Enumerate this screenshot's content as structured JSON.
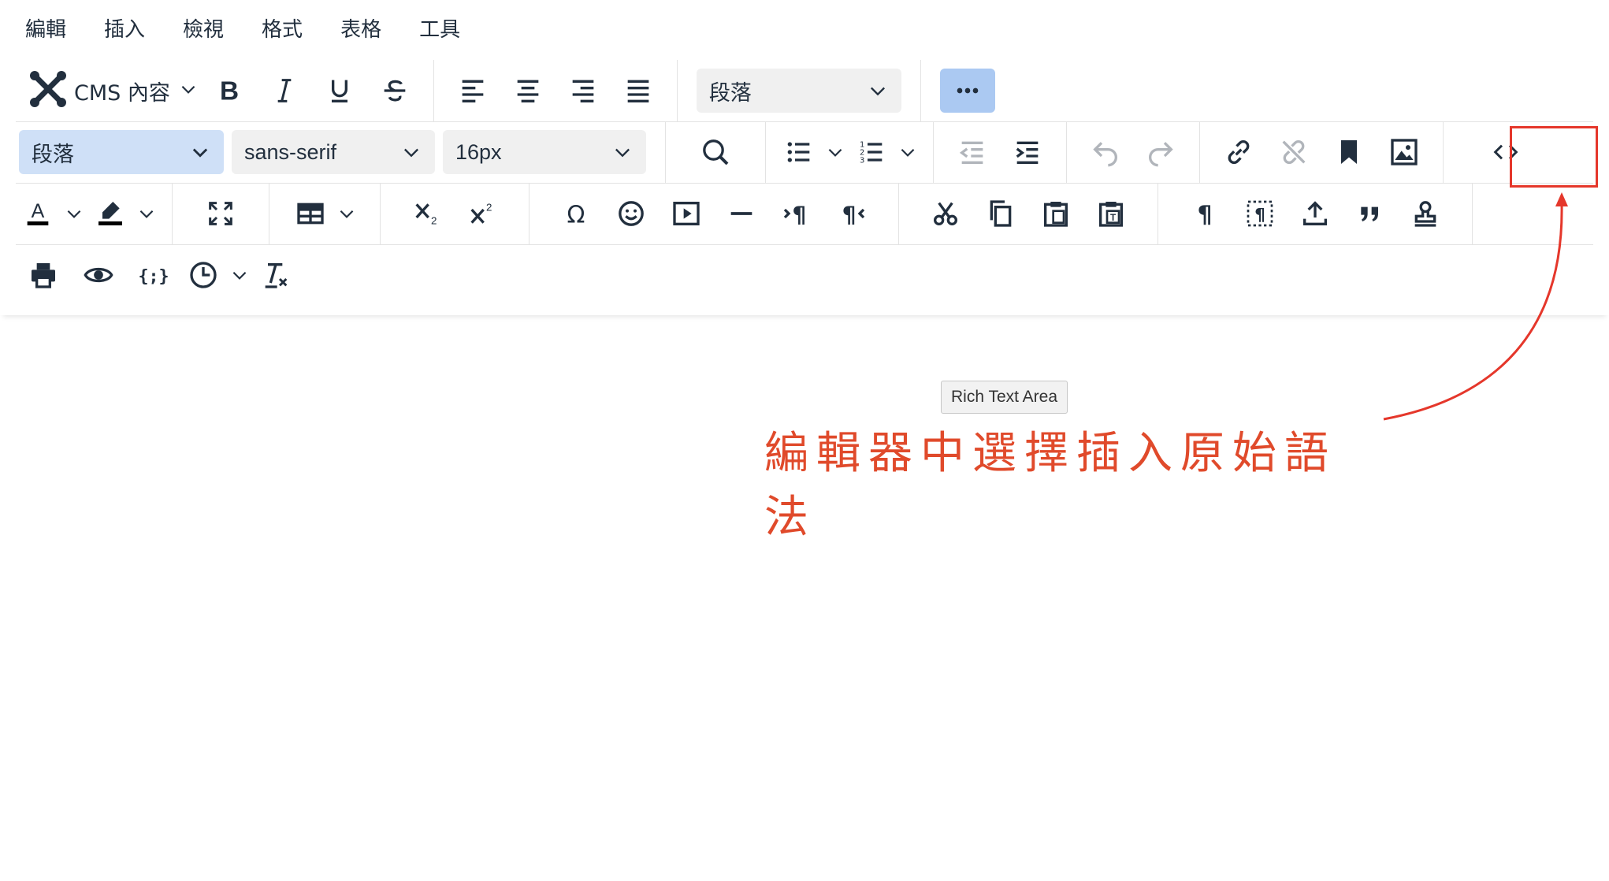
{
  "menubar": {
    "items": [
      {
        "label": "編輯"
      },
      {
        "label": "插入"
      },
      {
        "label": "檢視"
      },
      {
        "label": "格式"
      },
      {
        "label": "表格"
      },
      {
        "label": "工具"
      }
    ]
  },
  "toolbar": {
    "cms_label": "CMS 內容",
    "block_format_top": "段落",
    "block_format": "段落",
    "font_family": "sans-serif",
    "font_size": "16px",
    "icons": [
      "joomla-logo-icon",
      "bold-icon",
      "italic-icon",
      "underline-icon",
      "strikethrough-icon",
      "align-left-icon",
      "align-center-icon",
      "align-right-icon",
      "align-justify-icon",
      "more-icon",
      "search-icon",
      "bullet-list-icon",
      "numbered-list-icon",
      "outdent-icon",
      "indent-icon",
      "undo-icon",
      "redo-icon",
      "link-icon",
      "unlink-icon",
      "bookmark-icon",
      "image-icon",
      "source-code-icon",
      "text-color-icon",
      "highlight-icon",
      "fullscreen-icon",
      "table-icon",
      "subscript-icon",
      "superscript-icon",
      "omega-icon",
      "emoji-icon",
      "media-icon",
      "horizontal-rule-icon",
      "ltr-icon",
      "rtl-icon",
      "cut-icon",
      "copy-icon",
      "paste-icon",
      "paste-text-icon",
      "pilcrow-icon",
      "visual-blocks-icon",
      "insert-anchor-icon",
      "blockquote-icon",
      "template-icon",
      "print-icon",
      "preview-icon",
      "code-sample-icon",
      "datetime-icon",
      "clear-formatting-icon"
    ]
  },
  "editor": {
    "tooltip": "Rich Text Area"
  },
  "annotation": {
    "text": "編輯器中選擇插入原始語法",
    "color": "#e04a2b"
  },
  "colors": {
    "highlight_box": "#e5372b",
    "active_blue": "#abc9f2",
    "select_blue": "#cfe0f7",
    "icon": "#222f3e"
  }
}
